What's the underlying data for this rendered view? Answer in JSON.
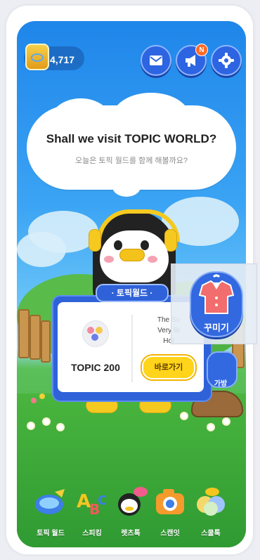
{
  "status": {
    "coins": "4,717",
    "notification_badge": "N"
  },
  "header": {
    "icons": [
      "coin-jar-icon",
      "mail-icon",
      "megaphone-icon",
      "gear-icon"
    ]
  },
  "speech": {
    "title": "Shall we visit TOPIC WORLD?",
    "subtitle": "오늘은 토픽 월드를 함께 해볼까요?"
  },
  "topic_card": {
    "tab_label": "· 토픽월드 ·",
    "name": "TOPIC 200",
    "description": "The Su\nVery Bi\nHot",
    "go_button": "바로가기"
  },
  "side": {
    "dress_up_label": "꾸미기",
    "bag_label": "가방"
  },
  "bottom_nav": {
    "items": [
      {
        "label": "토픽 월드",
        "icon": "airplane-icon"
      },
      {
        "label": "스피킹",
        "icon": "abc-icon"
      },
      {
        "label": "렛츠톡",
        "icon": "talk-penguin-icon"
      },
      {
        "label": "스캔잇",
        "icon": "camera-icon"
      },
      {
        "label": "스쿨톡",
        "icon": "school-chat-icon"
      }
    ]
  },
  "colors": {
    "primary_blue": "#2d64e2",
    "accent_yellow": "#ffd41a",
    "badge_orange": "#ff6b2a"
  }
}
